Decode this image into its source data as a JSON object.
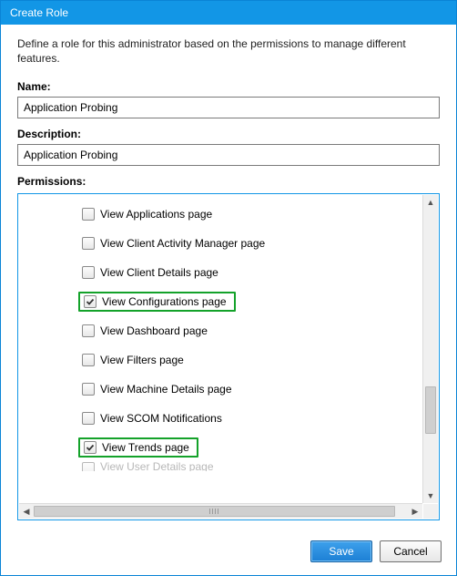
{
  "window": {
    "title": "Create Role"
  },
  "intro": "Define a role for this administrator based on the permissions to manage different features.",
  "labels": {
    "name": "Name:",
    "description": "Description:",
    "permissions": "Permissions:"
  },
  "fields": {
    "name": "Application Probing",
    "description": "Application Probing"
  },
  "permissions": [
    {
      "label": "View Applications page",
      "checked": false,
      "highlight": false
    },
    {
      "label": "View Client Activity Manager page",
      "checked": false,
      "highlight": false
    },
    {
      "label": "View Client Details page",
      "checked": false,
      "highlight": false
    },
    {
      "label": "View Configurations page",
      "checked": true,
      "highlight": true
    },
    {
      "label": "View Dashboard page",
      "checked": false,
      "highlight": false
    },
    {
      "label": "View Filters page",
      "checked": false,
      "highlight": false
    },
    {
      "label": "View Machine Details page",
      "checked": false,
      "highlight": false
    },
    {
      "label": "View SCOM Notifications",
      "checked": false,
      "highlight": false
    },
    {
      "label": "View Trends page",
      "checked": true,
      "highlight": true
    }
  ],
  "permissions_partial": {
    "label_fragment": "View User Details page"
  },
  "buttons": {
    "save": "Save",
    "cancel": "Cancel"
  }
}
